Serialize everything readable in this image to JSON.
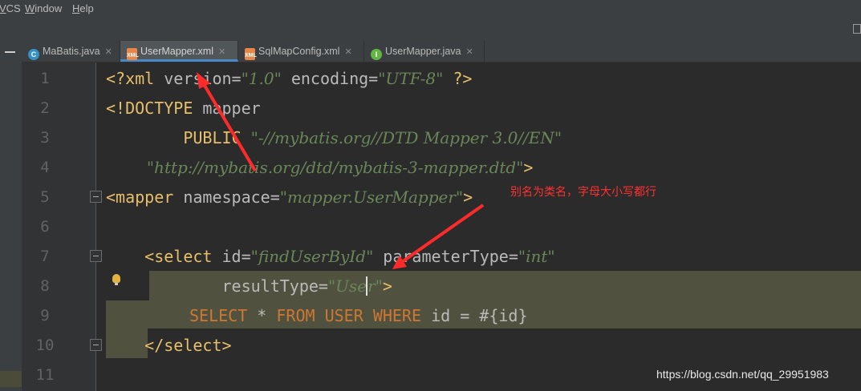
{
  "menu": [
    {
      "mnemonic": "V",
      "rest": "CS"
    },
    {
      "mnemonic": "W",
      "rest": "indow"
    },
    {
      "mnemonic": "H",
      "rest": "elp"
    }
  ],
  "tabs": [
    {
      "label": "MaBatis.java",
      "icon": "class-icon",
      "active": false
    },
    {
      "label": "UserMapper.xml",
      "icon": "xml-file-icon",
      "active": true
    },
    {
      "label": "SqlMapConfig.xml",
      "icon": "xml-file-icon",
      "active": false
    },
    {
      "label": "UserMapper.java",
      "icon": "interface-icon",
      "active": false
    }
  ],
  "line_numbers": [
    "1",
    "2",
    "3",
    "4",
    "5",
    "6",
    "7",
    "8",
    "9",
    "10",
    "11"
  ],
  "code": {
    "l1": {
      "p1": "<?xml ",
      "p2": "version=",
      "p3": "\"1.0\"",
      "p4": " encoding=",
      "p5": "\"UTF-8\"",
      "p6": " ?>"
    },
    "l2": {
      "p1": "<!DOCTYPE ",
      "p2": "mapper"
    },
    "l3": {
      "p1": "        PUBLIC ",
      "p2": "\"-//mybatis.org//DTD Mapper 3.0//EN\""
    },
    "l4": {
      "p1": "        \"http://mybatis.org/dtd/mybatis-3-mapper.dtd\"",
      "p2": ">"
    },
    "l5": {
      "p1": "<mapper ",
      "p2": "namespace=",
      "p3": "\"mapper.UserMapper\"",
      "p4": ">"
    },
    "l7": {
      "p1": "    <select ",
      "p2": "id=",
      "p3": "\"findUserById\"",
      "p4": " parameterType=",
      "p5": "\"int\""
    },
    "l8": {
      "p1": "            resultType=",
      "p2": "\"Use",
      "p3": "r\"",
      "p4": ">"
    },
    "l9": {
      "p1": "SELECT",
      "p2": " * ",
      "p3": "FROM",
      "p4": " ",
      "p5": "USER",
      "p6": " ",
      "p7": "WHERE",
      "p8": " id = #{id}"
    },
    "l10": {
      "p1": "    </select>"
    }
  },
  "annotation": "别名为类名，字母大小写都行",
  "watermark": "https://blog.csdn.net/qq_29951983",
  "colors": {
    "arrow": "#ff2a2a",
    "tag": "#e8bf6a",
    "string": "#6a8759",
    "keyword": "#cc7832",
    "highlight": "#51513f"
  }
}
